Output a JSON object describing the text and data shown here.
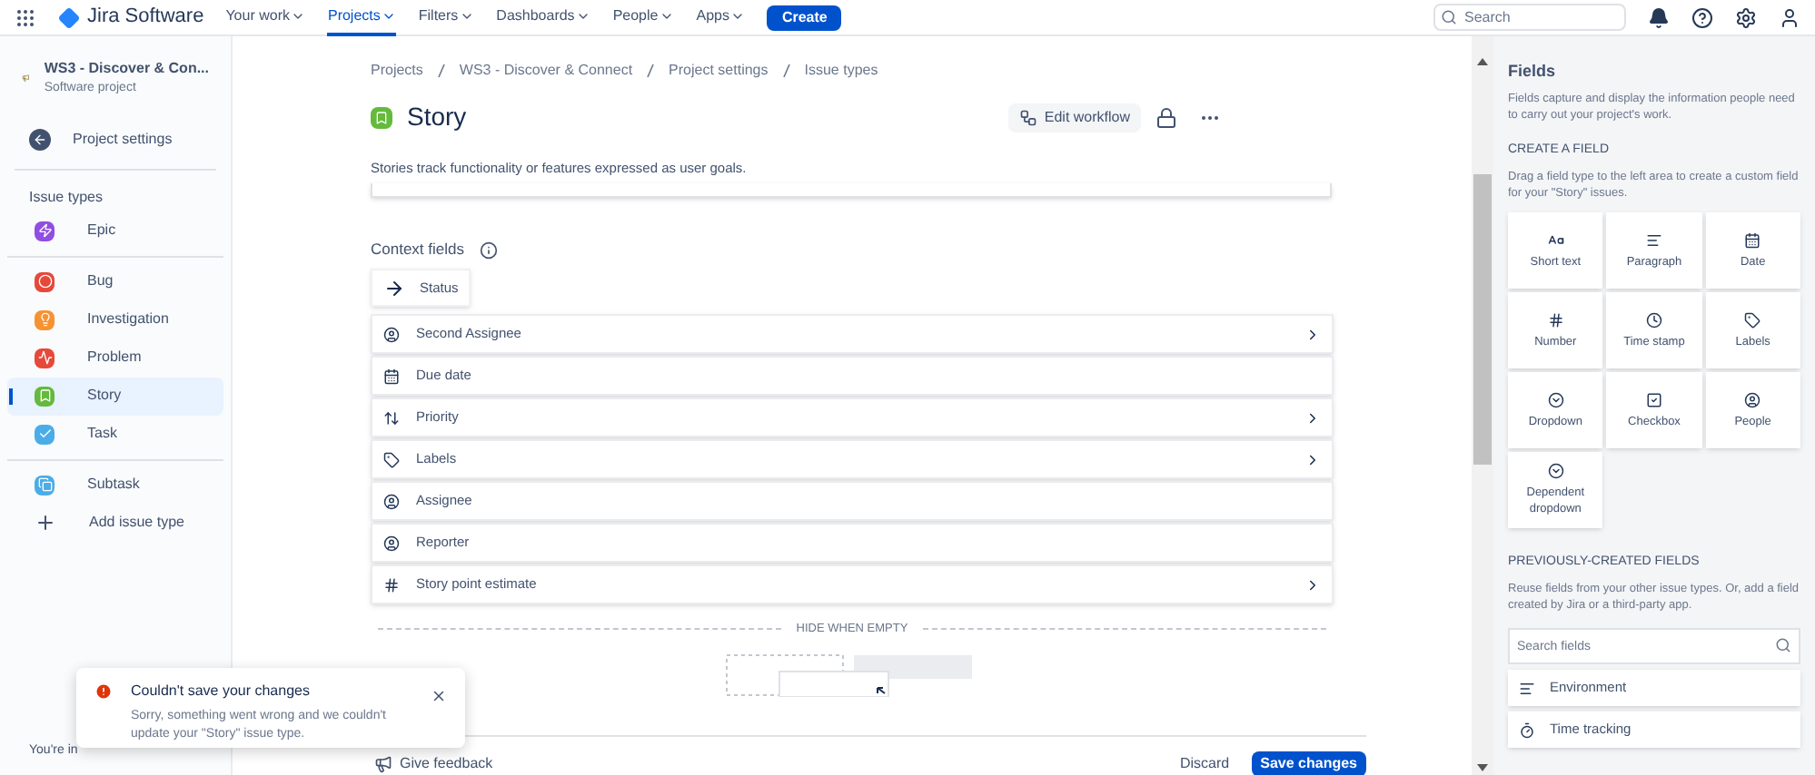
{
  "top_nav": {
    "product": "Jira Software",
    "items": [
      {
        "label": "Your work",
        "selected": false
      },
      {
        "label": "Projects",
        "selected": true
      },
      {
        "label": "Filters",
        "selected": false
      },
      {
        "label": "Dashboards",
        "selected": false
      },
      {
        "label": "People",
        "selected": false
      },
      {
        "label": "Apps",
        "selected": false
      }
    ],
    "create_button": "Create",
    "search": {
      "placeholder": "Search"
    }
  },
  "sidebar": {
    "project_name": "WS3 - Discover & Con...",
    "project_type": "Software project",
    "back_link": "Project settings",
    "section_title": "Issue types",
    "groups": [
      [
        {
          "label": "Epic",
          "kind": "epic",
          "selected": false
        }
      ],
      [
        {
          "label": "Bug",
          "kind": "bug",
          "selected": false
        },
        {
          "label": "Investigation",
          "kind": "investigation",
          "selected": false
        },
        {
          "label": "Problem",
          "kind": "problem",
          "selected": false
        },
        {
          "label": "Story",
          "kind": "story",
          "selected": true
        },
        {
          "label": "Task",
          "kind": "task",
          "selected": false
        }
      ],
      [
        {
          "label": "Subtask",
          "kind": "subtask",
          "selected": false
        },
        {
          "label": "Add issue type",
          "kind": "add",
          "selected": false
        }
      ]
    ],
    "footer_text": "You're in"
  },
  "main": {
    "breadcrumbs": [
      "Projects",
      "WS3 - Discover & Connect",
      "Project settings",
      "Issue types"
    ],
    "title": "Story",
    "edit_workflow": "Edit workflow",
    "description": "Stories track functionality or features expressed as user goals.",
    "context_title": "Context fields",
    "status_chip": "Status",
    "fields": [
      {
        "label": "Second Assignee",
        "kind": "person",
        "expandable": true
      },
      {
        "label": "Due date",
        "kind": "calendar",
        "expandable": false
      },
      {
        "label": "Priority",
        "kind": "priority",
        "expandable": true
      },
      {
        "label": "Labels",
        "kind": "tag",
        "expandable": true
      },
      {
        "label": "Assignee",
        "kind": "person",
        "expandable": false
      },
      {
        "label": "Reporter",
        "kind": "person",
        "expandable": false
      },
      {
        "label": "Story point estimate",
        "kind": "number",
        "expandable": true
      }
    ],
    "hide_when_empty": "HIDE WHEN EMPTY",
    "give_feedback": "Give feedback",
    "discard": "Discard",
    "save": "Save changes"
  },
  "toast": {
    "title": "Couldn't save your changes",
    "message": "Sorry, something went wrong and we couldn't update your \"Story\" issue type."
  },
  "fields_panel": {
    "title": "Fields",
    "intro": "Fields capture and display the information people need to carry out your project's work.",
    "create_title": "CREATE A FIELD",
    "create_hint": "Drag a field type to the left area to create a custom field for your \"Story\" issues.",
    "types": [
      {
        "label": "Short text",
        "kind": "text"
      },
      {
        "label": "Paragraph",
        "kind": "paragraph"
      },
      {
        "label": "Date",
        "kind": "date"
      },
      {
        "label": "Number",
        "kind": "number"
      },
      {
        "label": "Time stamp",
        "kind": "time"
      },
      {
        "label": "Labels",
        "kind": "labels"
      },
      {
        "label": "Dropdown",
        "kind": "dropdown"
      },
      {
        "label": "Checkbox",
        "kind": "checkbox"
      },
      {
        "label": "People",
        "kind": "people"
      },
      {
        "label": "Dependent dropdown",
        "kind": "dependent"
      }
    ],
    "previous_title": "PREVIOUSLY-CREATED FIELDS",
    "previous_hint": "Reuse fields from your other issue types. Or, add a field created by Jira or a third-party app.",
    "search": {
      "placeholder": "Search fields"
    },
    "existing": [
      {
        "label": "Environment",
        "kind": "paragraph"
      },
      {
        "label": "Time tracking",
        "kind": "stopwatch"
      }
    ]
  }
}
